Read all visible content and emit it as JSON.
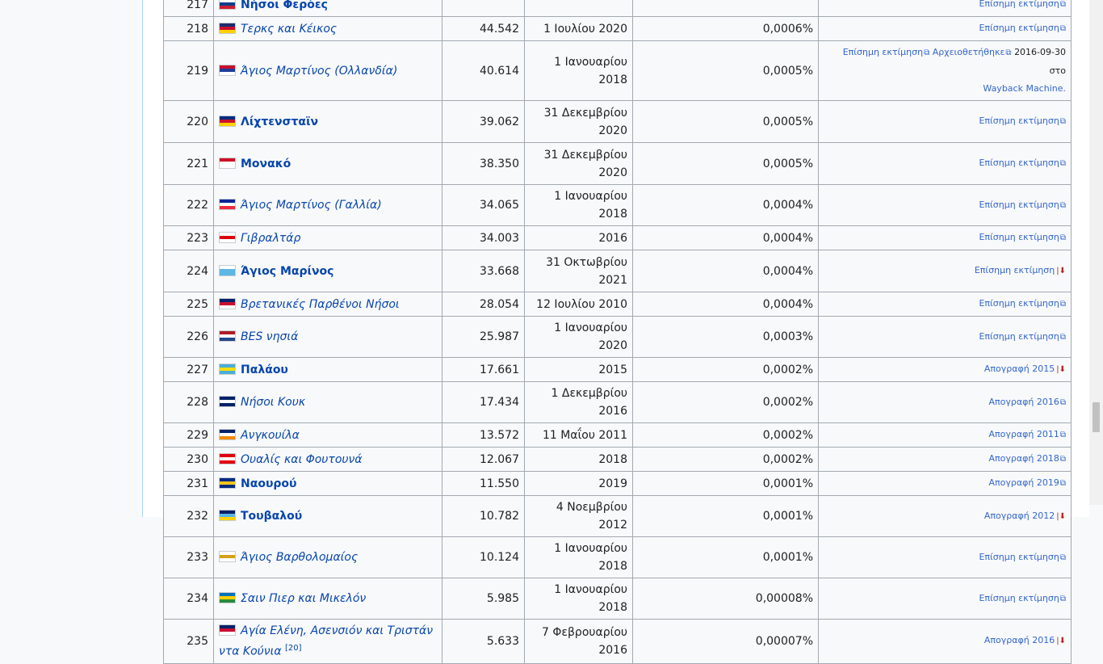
{
  "rows": [
    {
      "rank": "217",
      "name": "Νήσοι Φερόες",
      "style": "sov",
      "flag": [
        "#ffffff",
        "#0b3e8f",
        "#cc1f2e"
      ],
      "pop": "",
      "date": "",
      "pct": "",
      "src": "Επίσημη εκτίμηση"
    },
    {
      "rank": "218",
      "name": "Τερκς και Κέικος",
      "style": "dep",
      "flag": [
        "#1b2c6b",
        "#c8102e",
        "#ffd100"
      ],
      "pop": "44.542",
      "date": "1 Ιουλίου 2020",
      "pct": "0,0006%",
      "src": "Επίσημη εκτίμηση"
    },
    {
      "rank": "219",
      "name": "Άγιος Μαρτίνος (Ολλανδία)",
      "style": "dep",
      "flag": [
        "#c8102e",
        "#1f3d99",
        "#ffffff"
      ],
      "pop": "40.614",
      "date": "1 Ιανουαρίου 2018",
      "pct": "0,0005%",
      "src": "Επίσημη εκτίμηση",
      "src2": "Αρχειοθετήθηκε",
      "archive_date": "2016-09-30 στο",
      "wayback": "Wayback Machine."
    },
    {
      "rank": "220",
      "name": "Λίχτενσταϊν",
      "style": "sov",
      "flag": [
        "#002b7f",
        "#ce1126",
        "#ffd100"
      ],
      "pop": "39.062",
      "date": "31 Δεκεμβρίου 2020",
      "pct": "0,0005%",
      "src": "Επίσημη εκτίμηση"
    },
    {
      "rank": "221",
      "name": "Μονακό",
      "style": "sov",
      "flag": [
        "#ce1126",
        "#ffffff",
        "#ffffff"
      ],
      "pop": "38.350",
      "date": "31 Δεκεμβρίου 2020",
      "pct": "0,0005%",
      "src": "Επίσημη εκτίμηση"
    },
    {
      "rank": "222",
      "name": "Άγιος Μαρτίνος (Γαλλία)",
      "style": "dep",
      "flag": [
        "#002395",
        "#ffffff",
        "#ed2939"
      ],
      "pop": "34.065",
      "date": "1 Ιανουαρίου 2018",
      "pct": "0,0004%",
      "src": "Επίσημη εκτίμηση"
    },
    {
      "rank": "223",
      "name": "Γιβραλτάρ",
      "style": "dep",
      "flag": [
        "#ffffff",
        "#da000c",
        "#ffffff"
      ],
      "pop": "34.003",
      "date": "2016",
      "pct": "0,0004%",
      "src": "Επίσημη εκτίμηση"
    },
    {
      "rank": "224",
      "name": "Άγιος Μαρίνος",
      "style": "sov",
      "flag": [
        "#ffffff",
        "#5eb6e4",
        "#5eb6e4"
      ],
      "pop": "33.668",
      "date": "31 Οκτωβρίου 2021",
      "pct": "0,0004%",
      "src": "Επίσημη εκτίμηση",
      "pdf": true
    },
    {
      "rank": "225",
      "name": "Βρετανικές Παρθένοι Νήσοι",
      "style": "dep",
      "flag": [
        "#012169",
        "#c8102e",
        "#ffffff"
      ],
      "pop": "28.054",
      "date": "12 Ιουλίου 2010",
      "pct": "0,0004%",
      "src": "Επίσημη εκτίμηση"
    },
    {
      "rank": "226",
      "name": "BES νησιά",
      "style": "dep",
      "flag": [
        "#ae1c28",
        "#ffffff",
        "#21468b"
      ],
      "pop": "25.987",
      "date": "1 Ιανουαρίου 2020",
      "pct": "0,0003%",
      "src": "Επίσημη εκτίμηση"
    },
    {
      "rank": "227",
      "name": "Παλάου",
      "style": "sov",
      "flag": [
        "#4aadd6",
        "#ffde00",
        "#4aadd6"
      ],
      "pop": "17.661",
      "date": "2015",
      "pct": "0,0002%",
      "src": "Απογραφή 2015",
      "pdf": true
    },
    {
      "rank": "228",
      "name": "Νήσοι Κουκ",
      "style": "dep",
      "flag": [
        "#012169",
        "#ffffff",
        "#012169"
      ],
      "pop": "17.434",
      "date": "1 Δεκεμβρίου 2016",
      "pct": "0,0002%",
      "src": "Απογραφή 2016"
    },
    {
      "rank": "229",
      "name": "Ανγκουίλα",
      "style": "dep",
      "flag": [
        "#012169",
        "#ffffff",
        "#f28a00"
      ],
      "pop": "13.572",
      "date": "11 Μαΐου 2011",
      "pct": "0,0002%",
      "src": "Απογραφή 2011"
    },
    {
      "rank": "230",
      "name": "Ουαλίς και Φουτουνά",
      "style": "dep",
      "flag": [
        "#e1000f",
        "#ffffff",
        "#e1000f"
      ],
      "pop": "12.067",
      "date": "2018",
      "pct": "0,0002%",
      "src": "Απογραφή 2018"
    },
    {
      "rank": "231",
      "name": "Ναουρού",
      "style": "sov",
      "flag": [
        "#002b7f",
        "#ffc61e",
        "#002b7f"
      ],
      "pop": "11.550",
      "date": "2019",
      "pct": "0,0001%",
      "src": "Απογραφή 2019"
    },
    {
      "rank": "232",
      "name": "Τουβαλού",
      "style": "sov",
      "flag": [
        "#012169",
        "#5ab4e5",
        "#ffd100"
      ],
      "pop": "10.782",
      "date": "4 Νοεμβρίου 2012",
      "pct": "0,0001%",
      "src": "Απογραφή 2012",
      "pdf": true
    },
    {
      "rank": "233",
      "name": "Άγιος Βαρθολομαίος",
      "style": "dep",
      "flag": [
        "#ffffff",
        "#d4a017",
        "#ffffff"
      ],
      "pop": "10.124",
      "date": "1 Ιανουαρίου 2018",
      "pct": "0,0001%",
      "src": "Επίσημη εκτίμηση"
    },
    {
      "rank": "234",
      "name": "Σαιν Πιερ και Μικελόν",
      "style": "dep",
      "flag": [
        "#0072bc",
        "#ffd100",
        "#2a8a3b"
      ],
      "pop": "5.985",
      "date": "1 Ιανουαρίου 2018",
      "pct": "0,00008%",
      "src": "Επίσημη εκτίμηση"
    },
    {
      "rank": "235",
      "name": "Αγία Ελένη, Ασενσιόν και Τριστάν ντα Κούνια",
      "style": "dep",
      "flag": [
        "#012169",
        "#c8102e",
        "#ffffff"
      ],
      "pop": "5.633",
      "date": "7 Φεβρουαρίου 2016",
      "pct": "0,00007%",
      "src": "Απογραφή 2016",
      "pdf": true,
      "ref": "[20]"
    }
  ]
}
